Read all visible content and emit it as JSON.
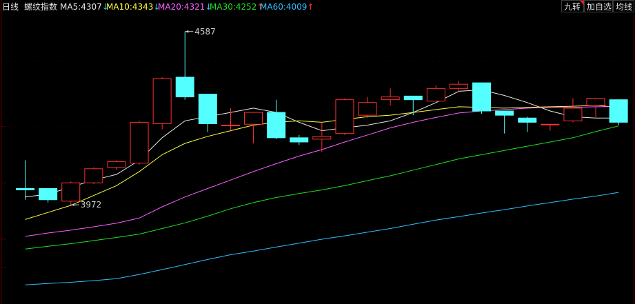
{
  "header": {
    "period": "日线",
    "index_name": "螺纹指数",
    "ma": [
      {
        "label": "MA5:",
        "value": "4307",
        "arrow": "↓",
        "dir": "down",
        "color": "#e8e8e8"
      },
      {
        "label": "MA10:",
        "value": "4343",
        "arrow": "↓",
        "dir": "down",
        "color": "#ffff40"
      },
      {
        "label": "MA20:",
        "value": "4321",
        "arrow": "↓",
        "dir": "down",
        "color": "#ff60ff"
      },
      {
        "label": "MA30:",
        "value": "4252",
        "arrow": "↑",
        "dir": "up",
        "color": "#20e020"
      },
      {
        "label": "MA60:",
        "value": "4009",
        "arrow": "↑",
        "dir": "up",
        "color": "#30c0ff"
      }
    ],
    "buttons": [
      "九转",
      "加自选",
      "均线"
    ]
  },
  "chart_data": {
    "type": "candlestick",
    "colors": {
      "up": "#ff3030",
      "down": "#54ffff",
      "background": "#000000",
      "grid": "#7a0000"
    },
    "ylim": [
      3620,
      4650
    ],
    "candles": [
      {
        "o": 4030,
        "h": 4130,
        "l": 3990,
        "c": 4025
      },
      {
        "o": 4030,
        "h": 4030,
        "l": 3980,
        "c": 3990
      },
      {
        "o": 3985,
        "h": 4055,
        "l": 3972,
        "c": 4050
      },
      {
        "o": 4050,
        "h": 4105,
        "l": 4045,
        "c": 4100
      },
      {
        "o": 4105,
        "h": 4130,
        "l": 4095,
        "c": 4125
      },
      {
        "o": 4120,
        "h": 4270,
        "l": 4115,
        "c": 4265
      },
      {
        "o": 4260,
        "h": 4425,
        "l": 4240,
        "c": 4420
      },
      {
        "o": 4425,
        "h": 4587,
        "l": 4345,
        "c": 4355
      },
      {
        "o": 4365,
        "h": 4365,
        "l": 4230,
        "c": 4260
      },
      {
        "o": 4255,
        "h": 4315,
        "l": 4235,
        "c": 4255
      },
      {
        "o": 4258,
        "h": 4300,
        "l": 4190,
        "c": 4300
      },
      {
        "o": 4300,
        "h": 4345,
        "l": 4205,
        "c": 4210
      },
      {
        "o": 4210,
        "h": 4220,
        "l": 4185,
        "c": 4195
      },
      {
        "o": 4205,
        "h": 4265,
        "l": 4160,
        "c": 4215
      },
      {
        "o": 4225,
        "h": 4350,
        "l": 4220,
        "c": 4345
      },
      {
        "o": 4290,
        "h": 4355,
        "l": 4280,
        "c": 4335
      },
      {
        "o": 4345,
        "h": 4385,
        "l": 4325,
        "c": 4355
      },
      {
        "o": 4358,
        "h": 4358,
        "l": 4290,
        "c": 4345
      },
      {
        "o": 4340,
        "h": 4397,
        "l": 4340,
        "c": 4385
      },
      {
        "o": 4385,
        "h": 4412,
        "l": 4373,
        "c": 4400
      },
      {
        "o": 4405,
        "h": 4405,
        "l": 4295,
        "c": 4305
      },
      {
        "o": 4305,
        "h": 4305,
        "l": 4225,
        "c": 4290
      },
      {
        "o": 4280,
        "h": 4285,
        "l": 4230,
        "c": 4265
      },
      {
        "o": 4258,
        "h": 4258,
        "l": 4235,
        "c": 4258
      },
      {
        "o": 4270,
        "h": 4350,
        "l": 4265,
        "c": 4315
      },
      {
        "o": 4325,
        "h": 4350,
        "l": 4280,
        "c": 4350
      },
      {
        "o": 4345,
        "h": 4345,
        "l": 4255,
        "c": 4265
      }
    ],
    "annotations": [
      {
        "label": "4587",
        "candle": 7,
        "value": 4587
      },
      {
        "label": "3972",
        "candle": 2,
        "value": 3972
      }
    ],
    "ma_series": [
      {
        "name": "MA5",
        "color": "#e8e8e8",
        "points": [
          [
            0.5,
            4000
          ],
          [
            1.5,
            4010
          ],
          [
            2.5,
            4035
          ],
          [
            3.5,
            4060
          ],
          [
            4.5,
            4080
          ],
          [
            5.5,
            4130
          ],
          [
            6.5,
            4210
          ],
          [
            7.5,
            4270
          ],
          [
            8.5,
            4285
          ],
          [
            9.5,
            4300
          ],
          [
            10.5,
            4315
          ],
          [
            11.5,
            4300
          ],
          [
            12.5,
            4265
          ],
          [
            13.5,
            4235
          ],
          [
            14.5,
            4245
          ],
          [
            15.5,
            4255
          ],
          [
            16.5,
            4270
          ],
          [
            17.5,
            4300
          ],
          [
            18.5,
            4335
          ],
          [
            19.5,
            4375
          ],
          [
            20.5,
            4380
          ],
          [
            21.5,
            4360
          ],
          [
            22.5,
            4335
          ],
          [
            23.5,
            4305
          ],
          [
            24.5,
            4285
          ],
          [
            25.5,
            4280
          ],
          [
            26.5,
            4280
          ]
        ]
      },
      {
        "name": "MA10",
        "color": "#ffff40",
        "points": [
          [
            0.5,
            3920
          ],
          [
            1.5,
            3945
          ],
          [
            2.5,
            3970
          ],
          [
            3.5,
            4005
          ],
          [
            4.5,
            4040
          ],
          [
            5.5,
            4090
          ],
          [
            6.5,
            4150
          ],
          [
            7.5,
            4190
          ],
          [
            8.5,
            4215
          ],
          [
            9.5,
            4235
          ],
          [
            10.5,
            4255
          ],
          [
            11.5,
            4265
          ],
          [
            12.5,
            4270
          ],
          [
            13.5,
            4265
          ],
          [
            14.5,
            4275
          ],
          [
            15.5,
            4285
          ],
          [
            16.5,
            4290
          ],
          [
            17.5,
            4300
          ],
          [
            18.5,
            4310
          ],
          [
            19.5,
            4320
          ],
          [
            20.5,
            4318
          ],
          [
            21.5,
            4315
          ],
          [
            22.5,
            4318
          ],
          [
            23.5,
            4320
          ],
          [
            24.5,
            4322
          ],
          [
            25.5,
            4325
          ],
          [
            26.5,
            4318
          ]
        ]
      },
      {
        "name": "MA20",
        "color": "#ff60ff",
        "points": [
          [
            0.5,
            3860
          ],
          [
            1.5,
            3872
          ],
          [
            2.5,
            3882
          ],
          [
            3.5,
            3894
          ],
          [
            4.5,
            3907
          ],
          [
            5.5,
            3925
          ],
          [
            6.5,
            3965
          ],
          [
            7.5,
            4000
          ],
          [
            8.5,
            4030
          ],
          [
            9.5,
            4060
          ],
          [
            10.5,
            4090
          ],
          [
            11.5,
            4118
          ],
          [
            12.5,
            4145
          ],
          [
            13.5,
            4168
          ],
          [
            14.5,
            4195
          ],
          [
            15.5,
            4220
          ],
          [
            16.5,
            4245
          ],
          [
            17.5,
            4265
          ],
          [
            18.5,
            4282
          ],
          [
            19.5,
            4298
          ],
          [
            20.5,
            4305
          ],
          [
            21.5,
            4310
          ],
          [
            22.5,
            4315
          ],
          [
            23.5,
            4318
          ],
          [
            24.5,
            4318
          ],
          [
            25.5,
            4320
          ],
          [
            26.5,
            4321
          ]
        ]
      },
      {
        "name": "MA30",
        "color": "#20e020",
        "points": [
          [
            0.5,
            3815
          ],
          [
            1.5,
            3825
          ],
          [
            2.5,
            3834
          ],
          [
            3.5,
            3845
          ],
          [
            4.5,
            3856
          ],
          [
            5.5,
            3868
          ],
          [
            6.5,
            3888
          ],
          [
            7.5,
            3908
          ],
          [
            8.5,
            3932
          ],
          [
            9.5,
            3958
          ],
          [
            10.5,
            3980
          ],
          [
            11.5,
            3998
          ],
          [
            12.5,
            4012
          ],
          [
            13.5,
            4025
          ],
          [
            14.5,
            4040
          ],
          [
            15.5,
            4058
          ],
          [
            16.5,
            4075
          ],
          [
            17.5,
            4095
          ],
          [
            18.5,
            4115
          ],
          [
            19.5,
            4135
          ],
          [
            20.5,
            4150
          ],
          [
            21.5,
            4165
          ],
          [
            22.5,
            4180
          ],
          [
            23.5,
            4195
          ],
          [
            24.5,
            4210
          ],
          [
            25.5,
            4232
          ],
          [
            26.5,
            4252
          ]
        ]
      },
      {
        "name": "MA60",
        "color": "#30c0ff",
        "points": [
          [
            0.5,
            3688
          ],
          [
            1.5,
            3693
          ],
          [
            2.5,
            3697
          ],
          [
            3.5,
            3703
          ],
          [
            4.5,
            3710
          ],
          [
            5.5,
            3725
          ],
          [
            6.5,
            3742
          ],
          [
            7.5,
            3760
          ],
          [
            8.5,
            3778
          ],
          [
            9.5,
            3795
          ],
          [
            10.5,
            3808
          ],
          [
            11.5,
            3822
          ],
          [
            12.5,
            3836
          ],
          [
            13.5,
            3850
          ],
          [
            14.5,
            3862
          ],
          [
            15.5,
            3875
          ],
          [
            16.5,
            3888
          ],
          [
            17.5,
            3903
          ],
          [
            18.5,
            3918
          ],
          [
            19.5,
            3930
          ],
          [
            20.5,
            3943
          ],
          [
            21.5,
            3955
          ],
          [
            22.5,
            3968
          ],
          [
            23.5,
            3980
          ],
          [
            24.5,
            3992
          ],
          [
            25.5,
            4003
          ],
          [
            26.5,
            4016
          ]
        ]
      }
    ]
  }
}
